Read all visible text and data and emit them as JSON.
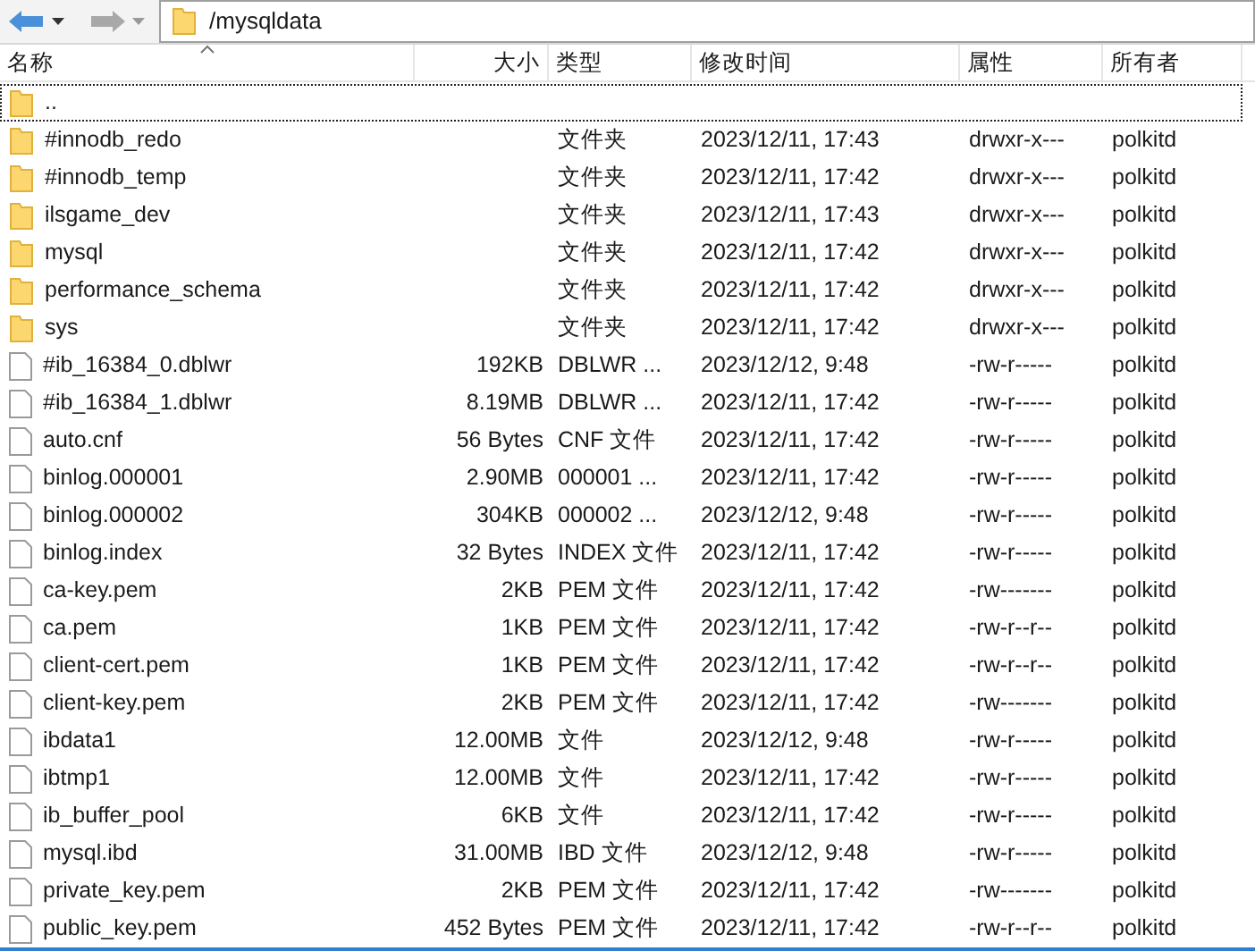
{
  "address_bar": {
    "path": "/mysqldata"
  },
  "columns": [
    {
      "label": "名称"
    },
    {
      "label": "大小"
    },
    {
      "label": "类型"
    },
    {
      "label": "修改时间"
    },
    {
      "label": "属性"
    },
    {
      "label": "所有者"
    }
  ],
  "rows": [
    {
      "kind": "folder",
      "focused": true,
      "name": ".."
    },
    {
      "kind": "folder",
      "focused": false,
      "name": "#innodb_redo",
      "type": "文件夹",
      "modified": "2023/12/11, 17:43",
      "attributes": "drwxr-x---",
      "owner": "polkitd"
    },
    {
      "kind": "folder",
      "focused": false,
      "name": "#innodb_temp",
      "type": "文件夹",
      "modified": "2023/12/11, 17:42",
      "attributes": "drwxr-x---",
      "owner": "polkitd"
    },
    {
      "kind": "folder",
      "focused": false,
      "name": "ilsgame_dev",
      "type": "文件夹",
      "modified": "2023/12/11, 17:43",
      "attributes": "drwxr-x---",
      "owner": "polkitd"
    },
    {
      "kind": "folder",
      "focused": false,
      "name": "mysql",
      "type": "文件夹",
      "modified": "2023/12/11, 17:42",
      "attributes": "drwxr-x---",
      "owner": "polkitd"
    },
    {
      "kind": "folder",
      "focused": false,
      "name": "performance_schema",
      "type": "文件夹",
      "modified": "2023/12/11, 17:42",
      "attributes": "drwxr-x---",
      "owner": "polkitd"
    },
    {
      "kind": "folder",
      "focused": false,
      "name": "sys",
      "type": "文件夹",
      "modified": "2023/12/11, 17:42",
      "attributes": "drwxr-x---",
      "owner": "polkitd"
    },
    {
      "kind": "file",
      "focused": false,
      "name": "#ib_16384_0.dblwr",
      "size": "192KB",
      "type": "DBLWR ...",
      "modified": "2023/12/12, 9:48",
      "attributes": "-rw-r-----",
      "owner": "polkitd"
    },
    {
      "kind": "file",
      "focused": false,
      "name": "#ib_16384_1.dblwr",
      "size": "8.19MB",
      "type": "DBLWR ...",
      "modified": "2023/12/11, 17:42",
      "attributes": "-rw-r-----",
      "owner": "polkitd"
    },
    {
      "kind": "file",
      "focused": false,
      "name": "auto.cnf",
      "size": "56 Bytes",
      "type": "CNF 文件",
      "modified": "2023/12/11, 17:42",
      "attributes": "-rw-r-----",
      "owner": "polkitd"
    },
    {
      "kind": "file",
      "focused": false,
      "name": "binlog.000001",
      "size": "2.90MB",
      "type": "000001 ...",
      "modified": "2023/12/11, 17:42",
      "attributes": "-rw-r-----",
      "owner": "polkitd"
    },
    {
      "kind": "file",
      "focused": false,
      "name": "binlog.000002",
      "size": "304KB",
      "type": "000002 ...",
      "modified": "2023/12/12, 9:48",
      "attributes": "-rw-r-----",
      "owner": "polkitd"
    },
    {
      "kind": "file",
      "focused": false,
      "name": "binlog.index",
      "size": "32 Bytes",
      "type": "INDEX 文件",
      "modified": "2023/12/11, 17:42",
      "attributes": "-rw-r-----",
      "owner": "polkitd"
    },
    {
      "kind": "file",
      "focused": false,
      "name": "ca-key.pem",
      "size": "2KB",
      "type": "PEM 文件",
      "modified": "2023/12/11, 17:42",
      "attributes": "-rw-------",
      "owner": "polkitd"
    },
    {
      "kind": "file",
      "focused": false,
      "name": "ca.pem",
      "size": "1KB",
      "type": "PEM 文件",
      "modified": "2023/12/11, 17:42",
      "attributes": "-rw-r--r--",
      "owner": "polkitd"
    },
    {
      "kind": "file",
      "focused": false,
      "name": "client-cert.pem",
      "size": "1KB",
      "type": "PEM 文件",
      "modified": "2023/12/11, 17:42",
      "attributes": "-rw-r--r--",
      "owner": "polkitd"
    },
    {
      "kind": "file",
      "focused": false,
      "name": "client-key.pem",
      "size": "2KB",
      "type": "PEM 文件",
      "modified": "2023/12/11, 17:42",
      "attributes": "-rw-------",
      "owner": "polkitd"
    },
    {
      "kind": "file",
      "focused": false,
      "name": "ibdata1",
      "size": "12.00MB",
      "type": "文件",
      "modified": "2023/12/12, 9:48",
      "attributes": "-rw-r-----",
      "owner": "polkitd"
    },
    {
      "kind": "file",
      "focused": false,
      "name": "ibtmp1",
      "size": "12.00MB",
      "type": "文件",
      "modified": "2023/12/11, 17:42",
      "attributes": "-rw-r-----",
      "owner": "polkitd"
    },
    {
      "kind": "file",
      "focused": false,
      "name": "ib_buffer_pool",
      "size": "6KB",
      "type": "文件",
      "modified": "2023/12/11, 17:42",
      "attributes": "-rw-r-----",
      "owner": "polkitd"
    },
    {
      "kind": "file",
      "focused": false,
      "name": "mysql.ibd",
      "size": "31.00MB",
      "type": "IBD 文件",
      "modified": "2023/12/12, 9:48",
      "attributes": "-rw-r-----",
      "owner": "polkitd"
    },
    {
      "kind": "file",
      "focused": false,
      "name": "private_key.pem",
      "size": "2KB",
      "type": "PEM 文件",
      "modified": "2023/12/11, 17:42",
      "attributes": "-rw-------",
      "owner": "polkitd"
    },
    {
      "kind": "file",
      "focused": false,
      "name": "public_key.pem",
      "size": "452 Bytes",
      "type": "PEM 文件",
      "modified": "2023/12/11, 17:42",
      "attributes": "-rw-r--r--",
      "owner": "polkitd"
    }
  ]
}
